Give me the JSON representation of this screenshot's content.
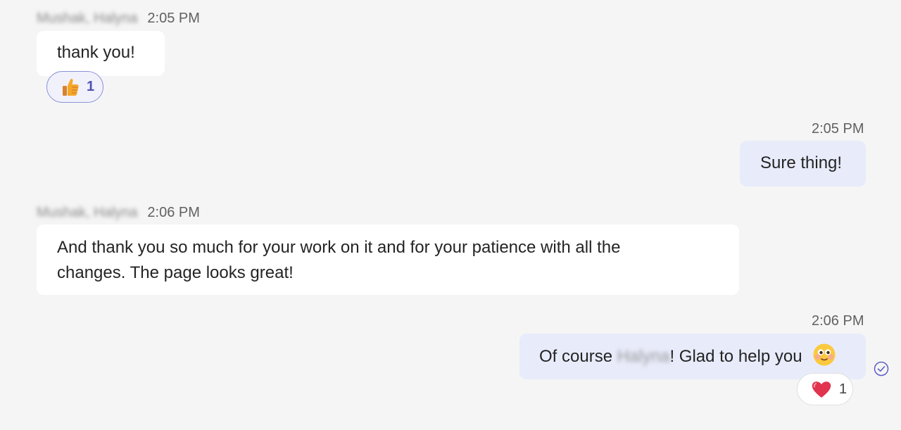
{
  "messages": [
    {
      "sender": "Mushak, Halyna",
      "time": "2:05 PM",
      "text": "thank you!",
      "reaction": {
        "icon": "thumbs-up-icon",
        "count": "1"
      }
    },
    {
      "time": "2:05 PM",
      "text": "Sure thing!"
    },
    {
      "sender": "Mushak, Halyna",
      "time": "2:06 PM",
      "text_line1": "And thank you so much for your work on it and for your patience with all the",
      "text_line2": "changes. The page looks great!"
    },
    {
      "time": "2:06 PM",
      "text_before": "Of course ",
      "mention": "Halyna",
      "text_after": "! Glad to help you",
      "emoji": "smiling-face-icon",
      "reaction": {
        "icon": "heart-icon",
        "count": "1"
      },
      "status_icon": "read-receipt-icon"
    }
  ],
  "colors": {
    "background": "#f5f5f5",
    "incoming_bubble": "#ffffff",
    "outgoing_bubble": "#e8ebfa",
    "accent": "#5b5fc7",
    "heart": "#e0344f",
    "thumb": "#f4a72a"
  }
}
